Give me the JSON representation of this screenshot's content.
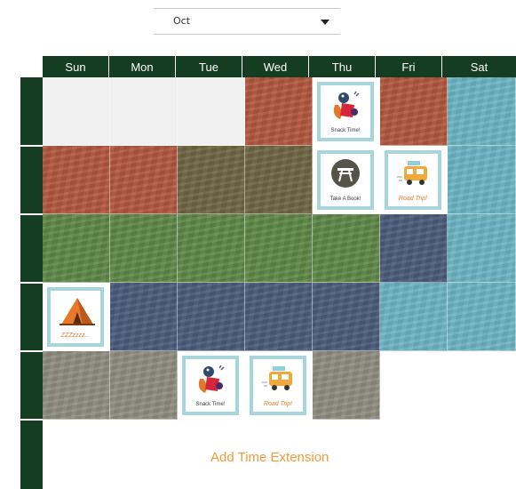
{
  "month_select": {
    "value": "Oct"
  },
  "days": [
    "Sun",
    "Mon",
    "Tue",
    "Wed",
    "Thu",
    "Fri",
    "Sat"
  ],
  "colors": {
    "header_bg": "#143d22",
    "empty": "#f0f0f0",
    "terracotta": "#b2563f",
    "brown": "#6e6443",
    "green": "#5f8748",
    "navy": "#4a5b7b",
    "teal": "#6cb4c4",
    "gray": "#8f8c7f",
    "accent": "#f39a35"
  },
  "events": {
    "snack": "Snack Time!",
    "book": "Take A Book!",
    "road": "Road Trip!",
    "sleep": "ZZZzzzz..."
  },
  "add_extension_label": "Add Time Extension"
}
